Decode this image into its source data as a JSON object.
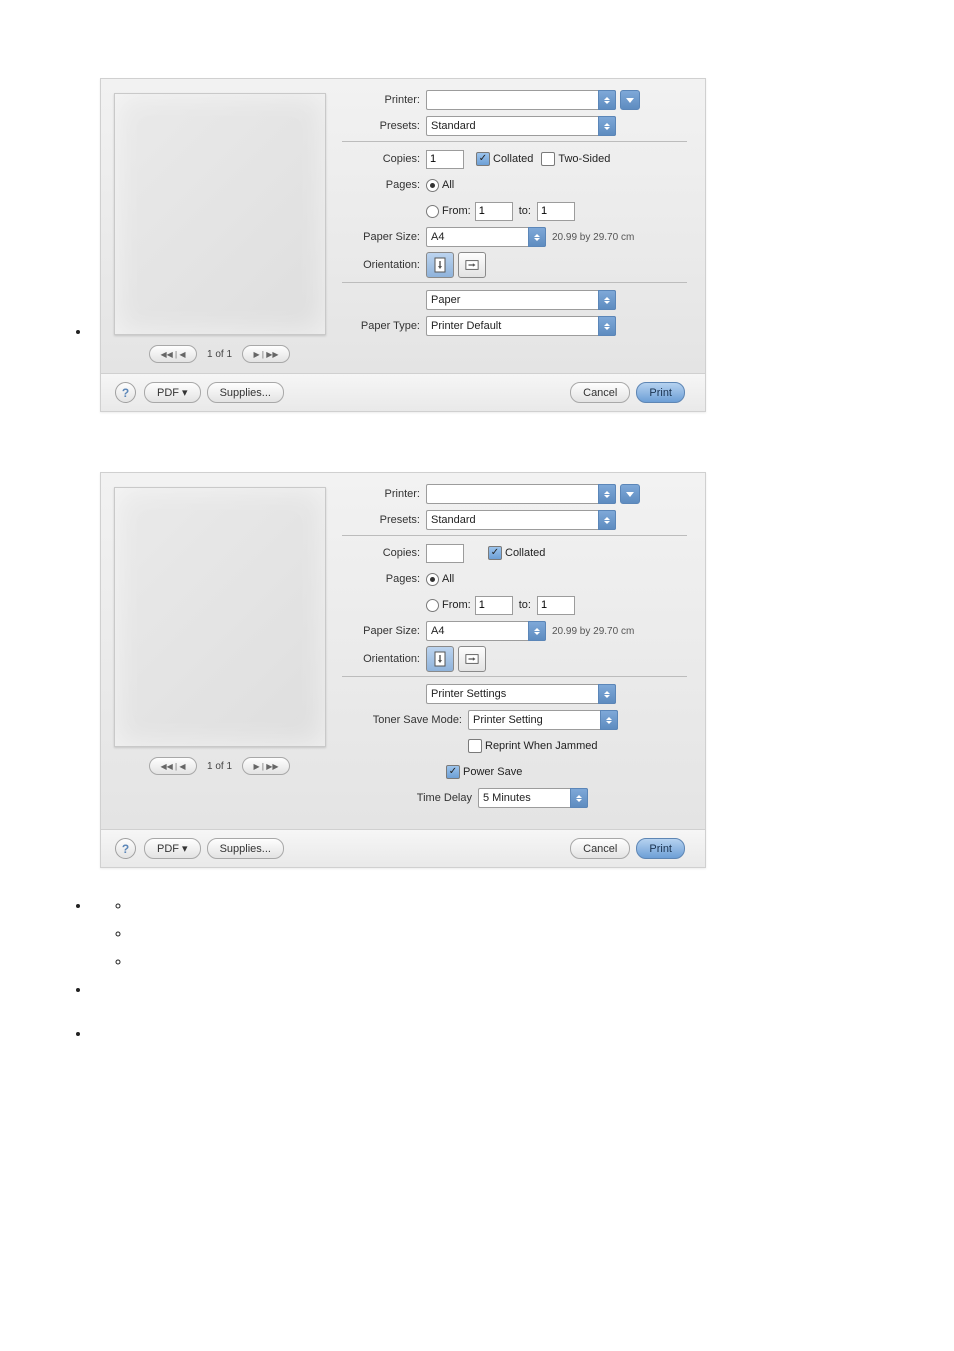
{
  "dialog1": {
    "labels": {
      "printer": "Printer:",
      "presets": "Presets:",
      "copies": "Copies:",
      "pages": "Pages:",
      "from": "From:",
      "to": "to:",
      "paper_size": "Paper Size:",
      "orientation": "Orientation:",
      "paper_type": "Paper Type:"
    },
    "values": {
      "printer": "",
      "presets": "Standard",
      "copies": "1",
      "pages_all": "All",
      "from": "1",
      "to": "1",
      "paper_size": "A4",
      "paper_size_dim": "20.99 by 29.70 cm",
      "section_drop": "Paper",
      "paper_type": "Printer Default"
    },
    "checks": {
      "collated": "Collated",
      "two_sided": "Two-Sided"
    },
    "nav": {
      "status": "1 of 1",
      "back": "◀◀ | ◀",
      "fwd": "▶ | ▶▶"
    },
    "footer": {
      "help": "?",
      "pdf": "PDF ▾",
      "supplies": "Supplies...",
      "cancel": "Cancel",
      "print": "Print"
    }
  },
  "dialog2": {
    "labels": {
      "printer": "Printer:",
      "presets": "Presets:",
      "copies": "Copies:",
      "pages": "Pages:",
      "from": "From:",
      "to": "to:",
      "paper_size": "Paper Size:",
      "orientation": "Orientation:",
      "toner_save": "Toner Save Mode:",
      "time_delay": "Time Delay"
    },
    "values": {
      "printer": "",
      "presets": "Standard",
      "copies": "",
      "pages_all": "All",
      "from": "1",
      "to": "1",
      "paper_size": "A4",
      "paper_size_dim": "20.99 by 29.70 cm",
      "section_drop": "Printer Settings",
      "toner_save": "Printer Setting",
      "time_delay": "5 Minutes"
    },
    "checks": {
      "collated": "Collated",
      "reprint": "Reprint When Jammed",
      "power_save": "Power Save"
    },
    "nav": {
      "status": "1 of 1",
      "back": "◀◀ | ◀",
      "fwd": "▶ | ▶▶"
    },
    "footer": {
      "help": "?",
      "pdf": "PDF ▾",
      "supplies": "Supplies...",
      "cancel": "Cancel",
      "print": "Print"
    }
  }
}
